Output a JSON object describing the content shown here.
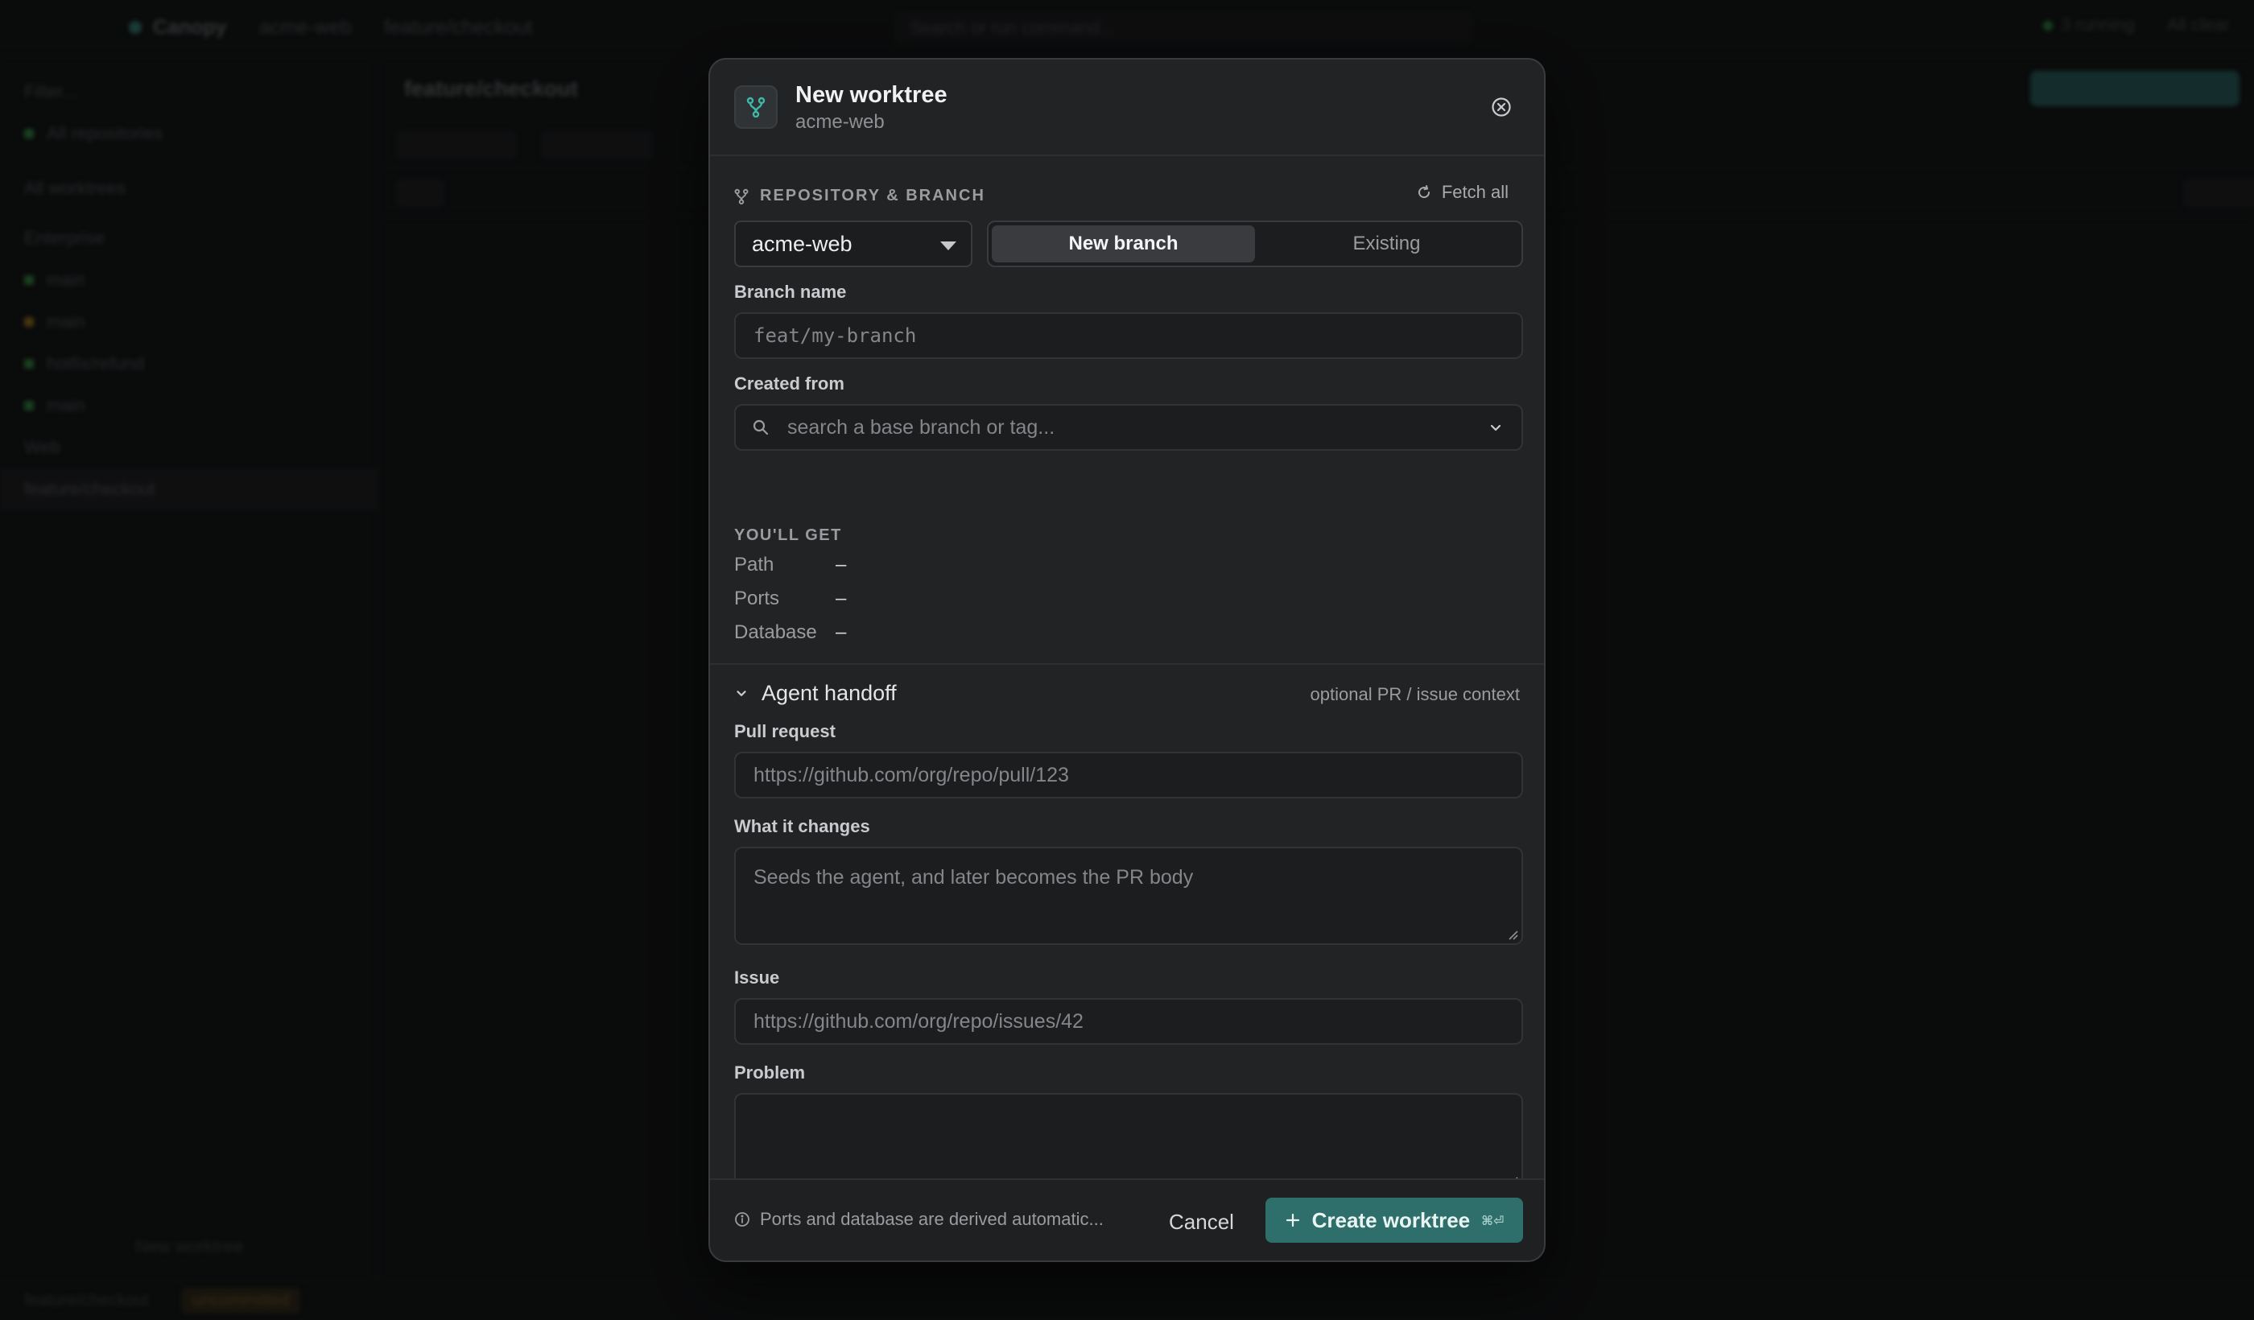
{
  "background": {
    "app_name": "Canopy",
    "breadcrumb": [
      "acme-web",
      "feature/checkout"
    ],
    "search_placeholder": "Search or run command...",
    "status_running": "3 running",
    "status_all_clear": "All clear",
    "sidebar": {
      "filter_placeholder": "Filter...",
      "items": [
        {
          "label": "All repositories"
        },
        {
          "label": "All worktrees"
        },
        {
          "label": "Enterprise"
        },
        {
          "label": "main"
        },
        {
          "label": "main"
        },
        {
          "label": "hotfix/refund"
        },
        {
          "label": "main"
        },
        {
          "label": "Web"
        },
        {
          "label": "feature/checkout"
        }
      ],
      "new_worktree": "New worktree"
    },
    "main_title": "feature/checkout",
    "status_bar": {
      "branch": "feature/checkout",
      "uncommitted": "uncommitted"
    }
  },
  "modal": {
    "title": "New worktree",
    "subtitle": "acme-web",
    "section_repo_branch": "REPOSITORY & BRANCH",
    "fetch_all": "Fetch all",
    "repo_value": "acme-web",
    "branch_mode": {
      "new": "New branch",
      "existing": "Existing"
    },
    "branch_name": {
      "label": "Branch name",
      "placeholder": "feat/my-branch"
    },
    "created_from": {
      "label": "Created from",
      "placeholder": "search a base branch or tag..."
    },
    "youll_get": {
      "title": "YOU'LL GET",
      "rows": [
        {
          "key": "Path",
          "value": "–"
        },
        {
          "key": "Ports",
          "value": "–"
        },
        {
          "key": "Database",
          "value": "–"
        }
      ]
    },
    "agent_handoff": {
      "title": "Agent handoff",
      "note": "optional PR / issue context",
      "pull_request": {
        "label": "Pull request",
        "placeholder": "https://github.com/org/repo/pull/123"
      },
      "what_changes": {
        "label": "What it changes",
        "placeholder": "Seeds the agent, and later becomes the PR body"
      },
      "issue": {
        "label": "Issue",
        "placeholder": "https://github.com/org/repo/issues/42"
      },
      "problem": {
        "label": "Problem",
        "placeholder": ""
      }
    },
    "footer": {
      "note": "Ports and database are derived automatic...",
      "cancel": "Cancel",
      "create": "Create worktree",
      "shortcut": "⌘⏎"
    }
  },
  "colors": {
    "accent": "#2f6f6b",
    "modal_bg": "#222325",
    "teal_icon": "#3fb8a8"
  }
}
